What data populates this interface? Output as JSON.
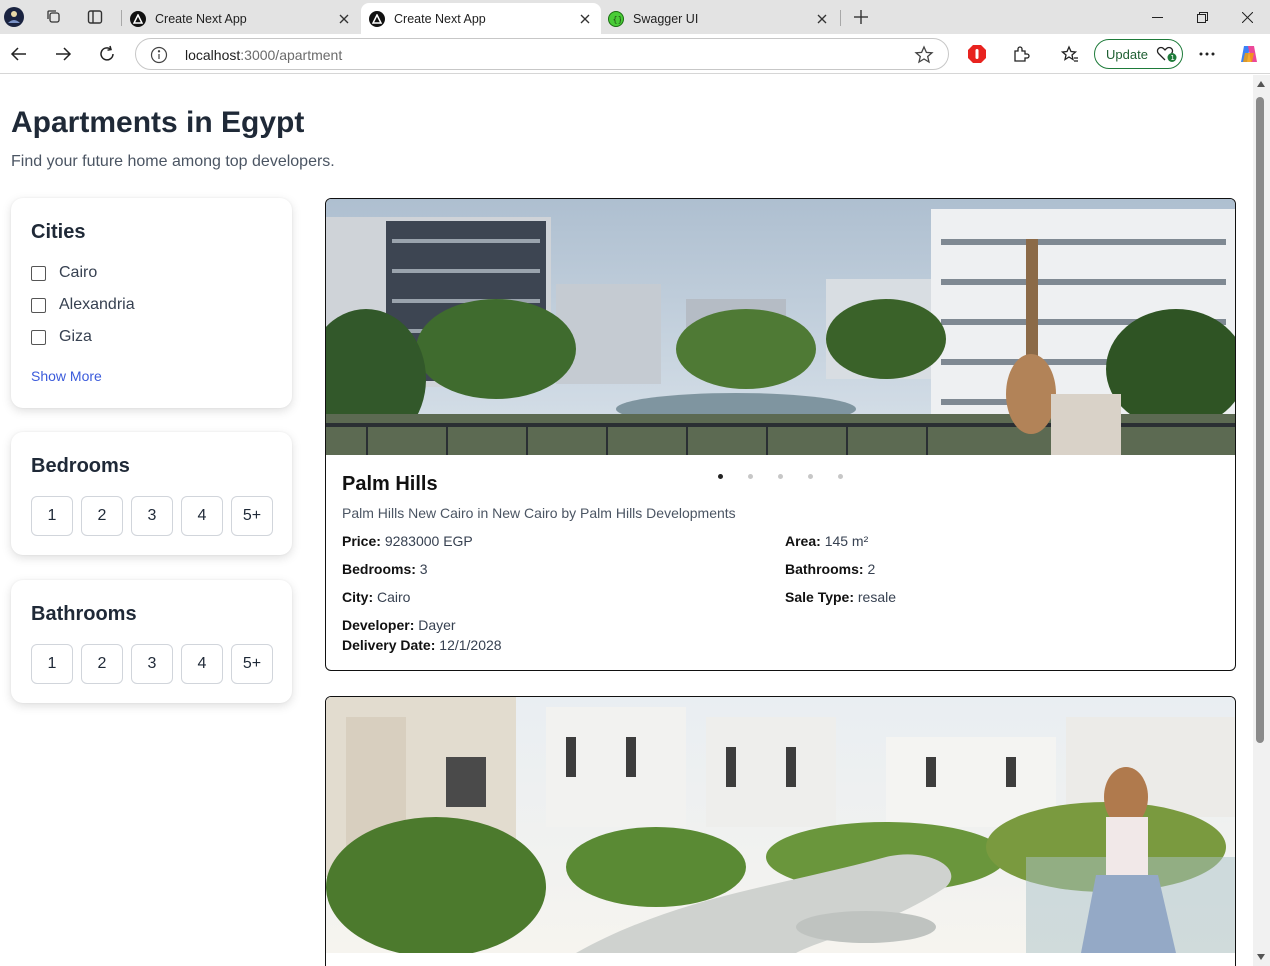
{
  "browser": {
    "tabs": [
      {
        "title": "Create Next App",
        "active": false,
        "icon": "nextjs-icon"
      },
      {
        "title": "Create Next App",
        "active": true,
        "icon": "nextjs-icon"
      },
      {
        "title": "Swagger UI",
        "active": false,
        "icon": "swagger-icon"
      }
    ],
    "url_host": "localhost",
    "url_path": ":3000/apartment",
    "update_label": "Update",
    "accent_color": "#1e7b3a"
  },
  "page": {
    "title": "Apartments in Egypt",
    "subtitle": "Find your future home among top developers."
  },
  "filters": {
    "cities": {
      "title": "Cities",
      "options": [
        "Cairo",
        "Alexandria",
        "Giza"
      ],
      "show_more": "Show More"
    },
    "bedrooms": {
      "title": "Bedrooms",
      "options": [
        "1",
        "2",
        "3",
        "4",
        "5+"
      ]
    },
    "bathrooms": {
      "title": "Bathrooms",
      "options": [
        "1",
        "2",
        "3",
        "4",
        "5+"
      ]
    }
  },
  "listings": [
    {
      "name": "Palm Hills",
      "description": "Palm Hills New Cairo in New Cairo by Palm Hills Developments",
      "price_label": "Price:",
      "price": "9283000 EGP",
      "area_label": "Area:",
      "area": "145 m²",
      "bedrooms_label": "Bedrooms:",
      "bedrooms": "3",
      "bathrooms_label": "Bathrooms:",
      "bathrooms": "2",
      "city_label": "City:",
      "city": "Cairo",
      "sale_type_label": "Sale Type:",
      "sale_type": "resale",
      "developer_label": "Developer:",
      "developer": "Dayer",
      "delivery_label": "Delivery Date:",
      "delivery": "12/1/2028",
      "carousel_count": 5,
      "carousel_active": 1
    },
    {
      "name": "",
      "carousel_count": 5
    }
  ]
}
